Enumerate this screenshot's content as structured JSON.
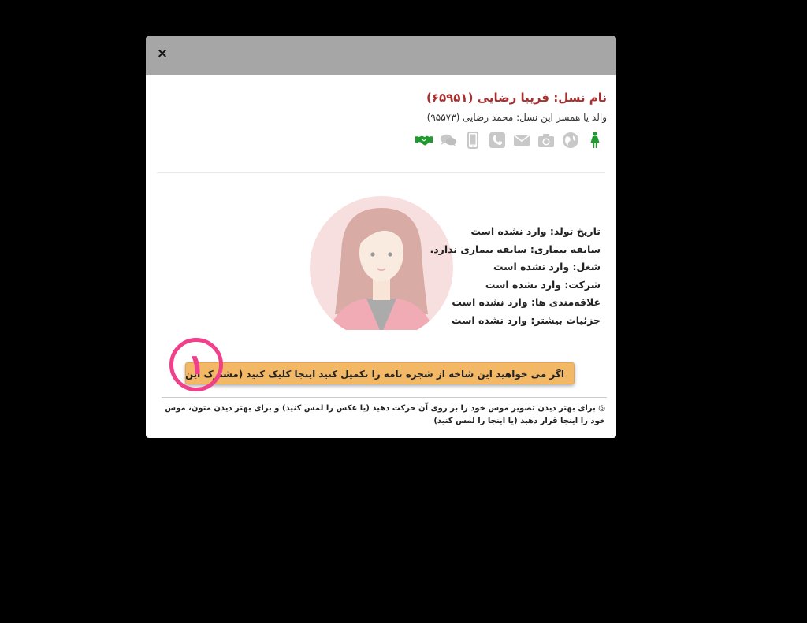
{
  "modal": {
    "close_label": "×",
    "name_line": "نام نسل: فریبا رضایی (۶۵۹۵۱)",
    "parent_line": "والد یا همسر این نسل: محمد رضایی (۹۵۵۷۳)",
    "icons": [
      "female-person-icon",
      "globe-icon",
      "camera-icon",
      "envelope-icon",
      "phone-icon",
      "mobile-icon",
      "chat-icon",
      "handshake-icon"
    ],
    "info": {
      "birth": "تاریخ تولد: وارد نشده است",
      "disease": "سابقه بیماری: سابقه بیماری ندارد.",
      "job": "شغل: وارد نشده است",
      "company": "شرکت: وارد نشده است",
      "interests": "علاقه‌مندی ها: وارد نشده است",
      "details": "جزئیات بیشتر: وارد نشده است"
    },
    "cta_label": "اگر می خواهید این شاخه از شجره نامه را تکمیل کنید اینجا کلیک کنید (مشترک این شجره نامه شوید)",
    "marker_label": "۱",
    "hint": "◎ برای بهتر دیدن تصویر موس خود را بر روی آن حرکت دهید (یا عکس را لمس کنید) و برای بهتر دیدن متون، موس خود را اینجا قرار دهید (یا اینجا را لمس کنید)"
  },
  "colors": {
    "header_bg": "#a6a6a6",
    "name_color": "#a83030",
    "cta_bg": "#f2b866",
    "marker_color": "#f0408a",
    "icon_gray": "#c8c8c8",
    "icon_green": "#1f9a2e"
  }
}
